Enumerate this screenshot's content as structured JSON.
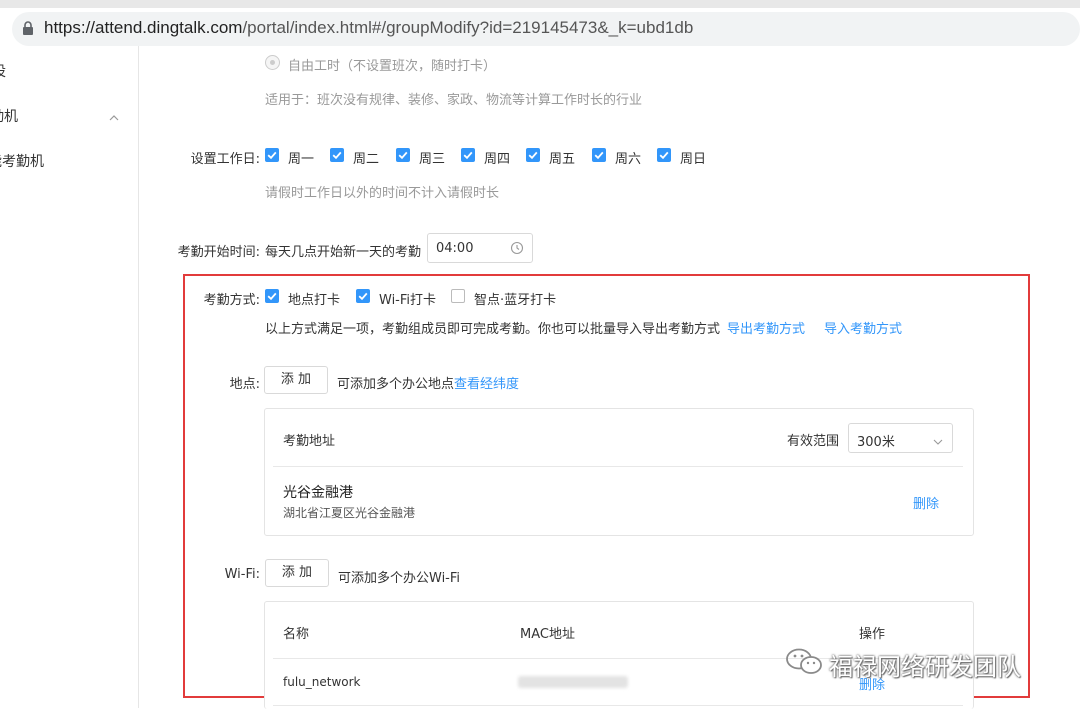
{
  "browser": {
    "url_host": "https://attend.dingtalk.com",
    "url_path": "/portal/index.html#/groupModify?id=219145473&_k=ubd1db"
  },
  "sidebar": {
    "items": [
      {
        "label": "设"
      },
      {
        "label": "勤机"
      },
      {
        "label": "能考勤机"
      }
    ]
  },
  "free_hours": {
    "label": "自由工时（不设置班次，随时打卡）",
    "hint": "适用于：班次没有规律、装修、家政、物流等计算工作时长的行业"
  },
  "workdays": {
    "label": "设置工作日:",
    "days": [
      "周一",
      "周二",
      "周三",
      "周四",
      "周五",
      "周六",
      "周日"
    ],
    "hint": "请假时工作日以外的时间不计入请假时长"
  },
  "start_time": {
    "label": "考勤开始时间:",
    "desc": "每天几点开始新一天的考勤",
    "value": "04:00"
  },
  "method": {
    "label": "考勤方式:",
    "options": [
      {
        "label": "地点打卡",
        "checked": true
      },
      {
        "label": "Wi-Fi打卡",
        "checked": true
      },
      {
        "label": "智点·蓝牙打卡",
        "checked": false
      }
    ],
    "hint": "以上方式满足一项，考勤组成员即可完成考勤。你也可以批量导入导出考勤方式",
    "export_link": "导出考勤方式",
    "import_link": "导入考勤方式"
  },
  "location": {
    "label": "地点:",
    "add_button": "添 加",
    "hint": "可添加多个办公地点",
    "view_link": "查看经纬度",
    "table_header": "考勤地址",
    "range_label": "有效范围",
    "range_value": "300米",
    "entries": [
      {
        "name": "光谷金融港",
        "address": "湖北省江夏区光谷金融港",
        "delete": "删除"
      }
    ]
  },
  "wifi": {
    "label": "Wi-Fi:",
    "add_button": "添 加",
    "hint": "可添加多个办公Wi-Fi",
    "columns": [
      "名称",
      "MAC地址",
      "操作"
    ],
    "rows": [
      {
        "name": "fulu_network",
        "delete": "删除"
      }
    ]
  },
  "watermark": {
    "text": "福禄网络研发团队"
  },
  "colors": {
    "accent": "#3296fa",
    "highlight_border": "#e23b3b"
  }
}
